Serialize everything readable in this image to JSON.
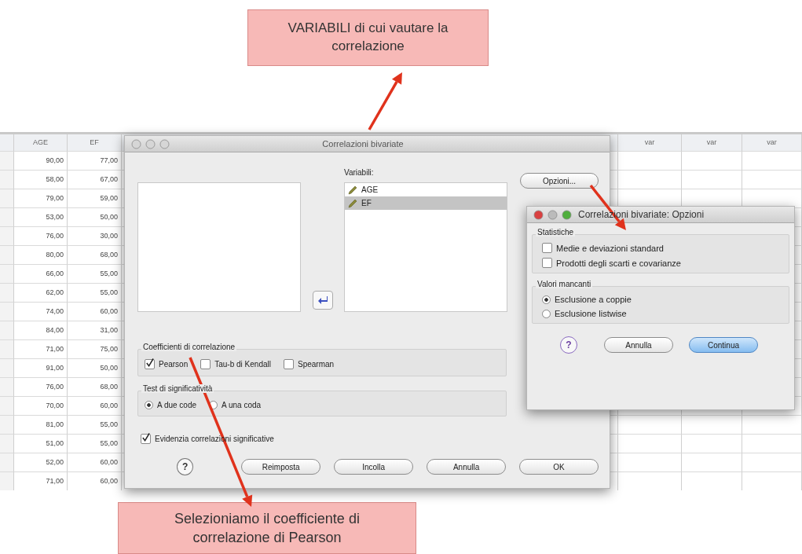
{
  "callout_top": {
    "text": "VARIABILI di cui vautare la correlazione"
  },
  "spreadsheet": {
    "columns": [
      "AGE",
      "EF",
      "var",
      "var",
      "var"
    ],
    "rows": [
      [
        "90,00",
        "77,00"
      ],
      [
        "58,00",
        "67,00"
      ],
      [
        "79,00",
        "59,00"
      ],
      [
        "53,00",
        "50,00"
      ],
      [
        "76,00",
        "30,00"
      ],
      [
        "80,00",
        "68,00"
      ],
      [
        "66,00",
        "55,00"
      ],
      [
        "62,00",
        "55,00"
      ],
      [
        "74,00",
        "60,00"
      ],
      [
        "84,00",
        "31,00"
      ],
      [
        "71,00",
        "75,00"
      ],
      [
        "91,00",
        "50,00"
      ],
      [
        "76,00",
        "68,00"
      ],
      [
        "70,00",
        "60,00"
      ],
      [
        "81,00",
        "55,00"
      ],
      [
        "51,00",
        "55,00"
      ],
      [
        "52,00",
        "60,00"
      ],
      [
        "71,00",
        "60,00"
      ]
    ]
  },
  "dialog": {
    "title": "Correlazioni bivariate",
    "variables_label": "Variabili:",
    "variables": [
      {
        "name": "AGE",
        "selected": false
      },
      {
        "name": "EF",
        "selected": true
      }
    ],
    "options_button": "Opzioni...",
    "coefficients": {
      "title": "Coefficienti di correlazione",
      "items": [
        {
          "label": "Pearson",
          "checked": true
        },
        {
          "label": "Tau-b di Kendall",
          "checked": false
        },
        {
          "label": "Spearman",
          "checked": false
        }
      ]
    },
    "test": {
      "title": "Test di significatività",
      "items": [
        {
          "label": "A due code",
          "selected": true
        },
        {
          "label": "A una coda",
          "selected": false
        }
      ]
    },
    "flag": {
      "label": "Evidenzia correlazioni significative",
      "checked": true
    },
    "help": "?",
    "buttons": [
      "Reimposta",
      "Incolla",
      "Annulla",
      "OK"
    ]
  },
  "options_dialog": {
    "title": "Correlazioni bivariate: Opzioni",
    "statistics": {
      "title": "Statistiche",
      "items": [
        {
          "label": "Medie e deviazioni standard",
          "checked": false
        },
        {
          "label": "Prodotti degli scarti e covarianze",
          "checked": false
        }
      ]
    },
    "missing": {
      "title": "Valori mancanti",
      "items": [
        {
          "label": "Esclusione a coppie",
          "selected": true
        },
        {
          "label": "Esclusione listwise",
          "selected": false
        }
      ]
    },
    "help": "?",
    "buttons": [
      {
        "label": "Annulla",
        "default": false
      },
      {
        "label": "Continua",
        "default": true
      }
    ]
  },
  "callout_bottom": {
    "text": "Selezioniamo il coefficiente di correlazione di Pearson"
  }
}
